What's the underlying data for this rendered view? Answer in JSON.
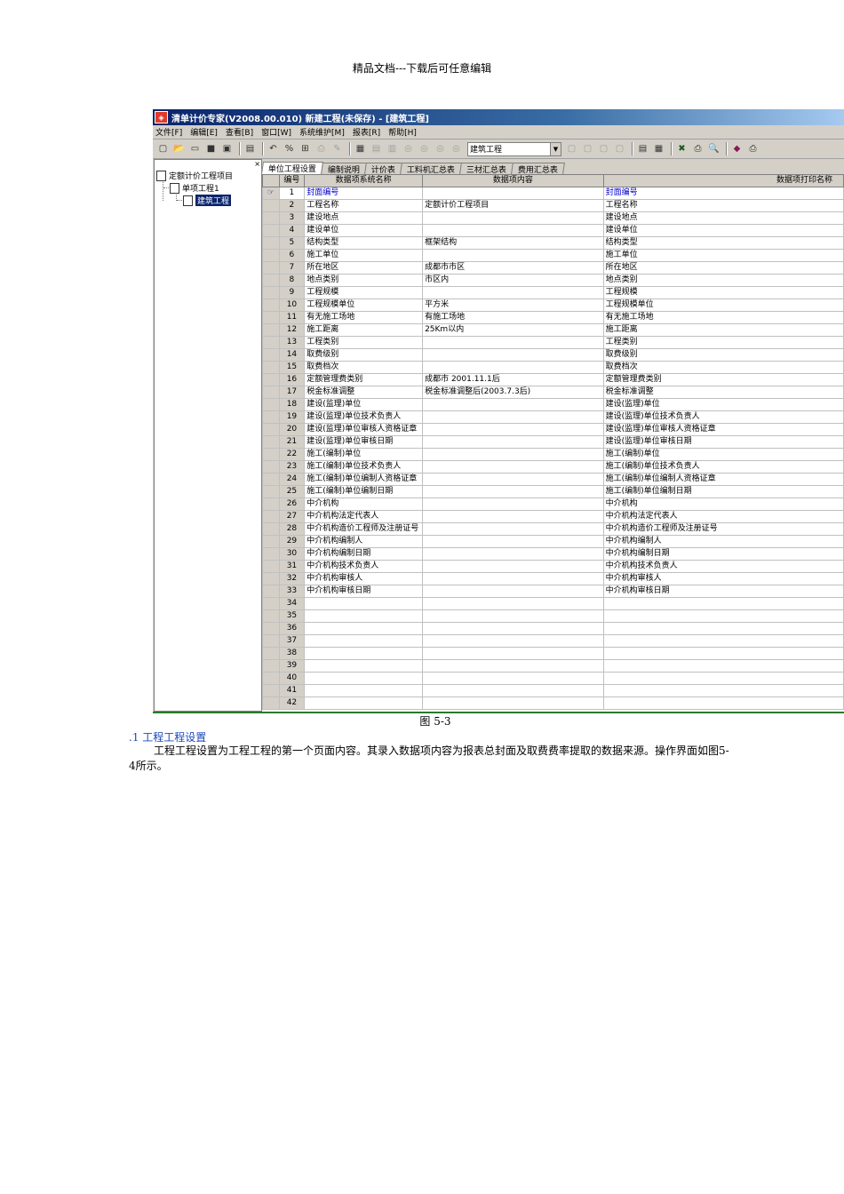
{
  "header_note": "精品文档---下载后可任意编辑",
  "app": {
    "title": "清单计价专家(V2008.00.010) 新建工程(未保存) - [建筑工程]",
    "menus": [
      "文件[F]",
      "编辑[E]",
      "查看[B]",
      "窗口[W]",
      "系统维护[M]",
      "报表[R]",
      "帮助[H]"
    ],
    "toolbar_dropdown": "建筑工程",
    "tree": {
      "root": "定额计价工程项目",
      "child": "单项工程1",
      "leaf": "建筑工程",
      "close": "×"
    },
    "tabs": [
      "单位工程设置",
      "编制说明",
      "计价表",
      "工料机汇总表",
      "三材汇总表",
      "费用汇总表"
    ],
    "grid": {
      "headers": [
        "编号",
        "数据项系统名称",
        "数据项内容",
        "数据项打印名称"
      ],
      "rows": [
        [
          "1",
          "封面编号",
          "",
          "封面编号"
        ],
        [
          "2",
          "工程名称",
          "定额计价工程项目",
          "工程名称"
        ],
        [
          "3",
          "建设地点",
          "",
          "建设地点"
        ],
        [
          "4",
          "建设单位",
          "",
          "建设单位"
        ],
        [
          "5",
          "结构类型",
          "框架结构",
          "结构类型"
        ],
        [
          "6",
          "施工单位",
          "",
          "施工单位"
        ],
        [
          "7",
          "所在地区",
          "成都市市区",
          "所在地区"
        ],
        [
          "8",
          "地点类别",
          "市区内",
          "地点类别"
        ],
        [
          "9",
          "工程规模",
          "",
          "工程规模"
        ],
        [
          "10",
          "工程规模单位",
          "平方米",
          "工程规模单位"
        ],
        [
          "11",
          "有无施工场地",
          "有施工场地",
          "有无施工场地"
        ],
        [
          "12",
          "施工距离",
          "25Km以内",
          "施工距离"
        ],
        [
          "13",
          "工程类别",
          "",
          "工程类别"
        ],
        [
          "14",
          "取费级别",
          "",
          "取费级别"
        ],
        [
          "15",
          "取费档次",
          "",
          "取费档次"
        ],
        [
          "16",
          "定额管理费类别",
          "成都市 2001.11.1后",
          "定额管理费类别"
        ],
        [
          "17",
          "税金标准调整",
          "税金标准调整后(2003.7.3后)",
          "税金标准调整"
        ],
        [
          "18",
          "建设(监理)单位",
          "",
          "建设(监理)单位"
        ],
        [
          "19",
          "建设(监理)单位技术负责人",
          "",
          "建设(监理)单位技术负责人"
        ],
        [
          "20",
          "建设(监理)单位审核人资格证章",
          "",
          "建设(监理)单位审核人资格证章"
        ],
        [
          "21",
          "建设(监理)单位审核日期",
          "",
          "建设(监理)单位审核日期"
        ],
        [
          "22",
          "施工(编制)单位",
          "",
          "施工(编制)单位"
        ],
        [
          "23",
          "施工(编制)单位技术负责人",
          "",
          "施工(编制)单位技术负责人"
        ],
        [
          "24",
          "施工(编制)单位编制人资格证章",
          "",
          "施工(编制)单位编制人资格证章"
        ],
        [
          "25",
          "施工(编制)单位编制日期",
          "",
          "施工(编制)单位编制日期"
        ],
        [
          "26",
          "中介机构",
          "",
          "中介机构"
        ],
        [
          "27",
          "中介机构法定代表人",
          "",
          "中介机构法定代表人"
        ],
        [
          "28",
          "中介机构造价工程师及注册证号",
          "",
          "中介机构造价工程师及注册证号"
        ],
        [
          "29",
          "中介机构编制人",
          "",
          "中介机构编制人"
        ],
        [
          "30",
          "中介机构编制日期",
          "",
          "中介机构编制日期"
        ],
        [
          "31",
          "中介机构技术负责人",
          "",
          "中介机构技术负责人"
        ],
        [
          "32",
          "中介机构审核人",
          "",
          "中介机构审核人"
        ],
        [
          "33",
          "中介机构审核日期",
          "",
          "中介机构审核日期"
        ],
        [
          "34",
          "",
          "",
          ""
        ],
        [
          "35",
          "",
          "",
          ""
        ],
        [
          "36",
          "",
          "",
          ""
        ],
        [
          "37",
          "",
          "",
          ""
        ],
        [
          "38",
          "",
          "",
          ""
        ],
        [
          "39",
          "",
          "",
          ""
        ],
        [
          "40",
          "",
          "",
          ""
        ],
        [
          "41",
          "",
          "",
          ""
        ],
        [
          "42",
          "",
          "",
          ""
        ]
      ]
    }
  },
  "caption": "图 5-3",
  "section_title": ".1 工程工程设置",
  "paragraph": "工程工程设置为工程工程的第一个页面内容。其录入数据项内容为报表总封面及取费费率提取的数据来源。操作界面如图5-4所示。"
}
